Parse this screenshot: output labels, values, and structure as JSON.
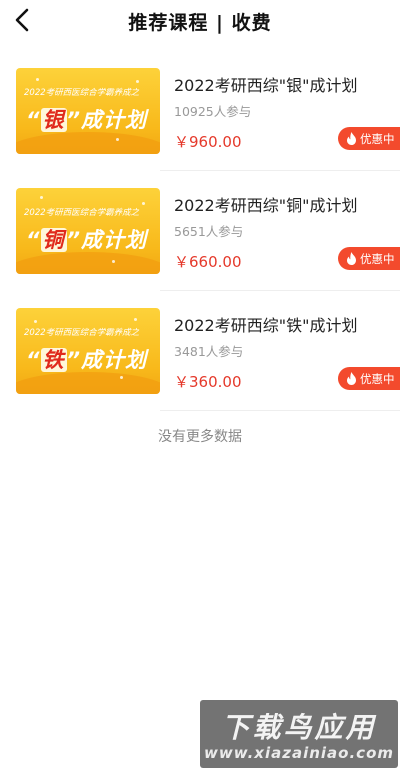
{
  "header": {
    "title": "推荐课程 | 收费"
  },
  "courses": [
    {
      "thumb_subtitle": "2022考研西医综合学霸养成之",
      "thumb_quote_open": "“",
      "thumb_highlight": "银",
      "thumb_quote_close": "”成计划",
      "name": "2022考研西综\"银\"成计划",
      "participants": "10925人参与",
      "price": "￥960.00",
      "badge": "优惠中"
    },
    {
      "thumb_subtitle": "2022考研西医综合学霸养成之",
      "thumb_quote_open": "“",
      "thumb_highlight": "铜",
      "thumb_quote_close": "”成计划",
      "name": "2022考研西综\"铜\"成计划",
      "participants": "5651人参与",
      "price": "￥660.00",
      "badge": "优惠中"
    },
    {
      "thumb_subtitle": "2022考研西医综合学霸养成之",
      "thumb_quote_open": "“",
      "thumb_highlight": "铁",
      "thumb_quote_close": "”成计划",
      "name": "2022考研西综\"铁\"成计划",
      "participants": "3481人参与",
      "price": "￥360.00",
      "badge": "优惠中"
    }
  ],
  "footer": {
    "no_more": "没有更多数据"
  },
  "watermark": {
    "main": "下载鸟应用",
    "url": "www.xiazainiao.com"
  },
  "colors": {
    "price": "#e5392b",
    "badge": "#f34a2d",
    "thumb": "#f8b91b"
  }
}
